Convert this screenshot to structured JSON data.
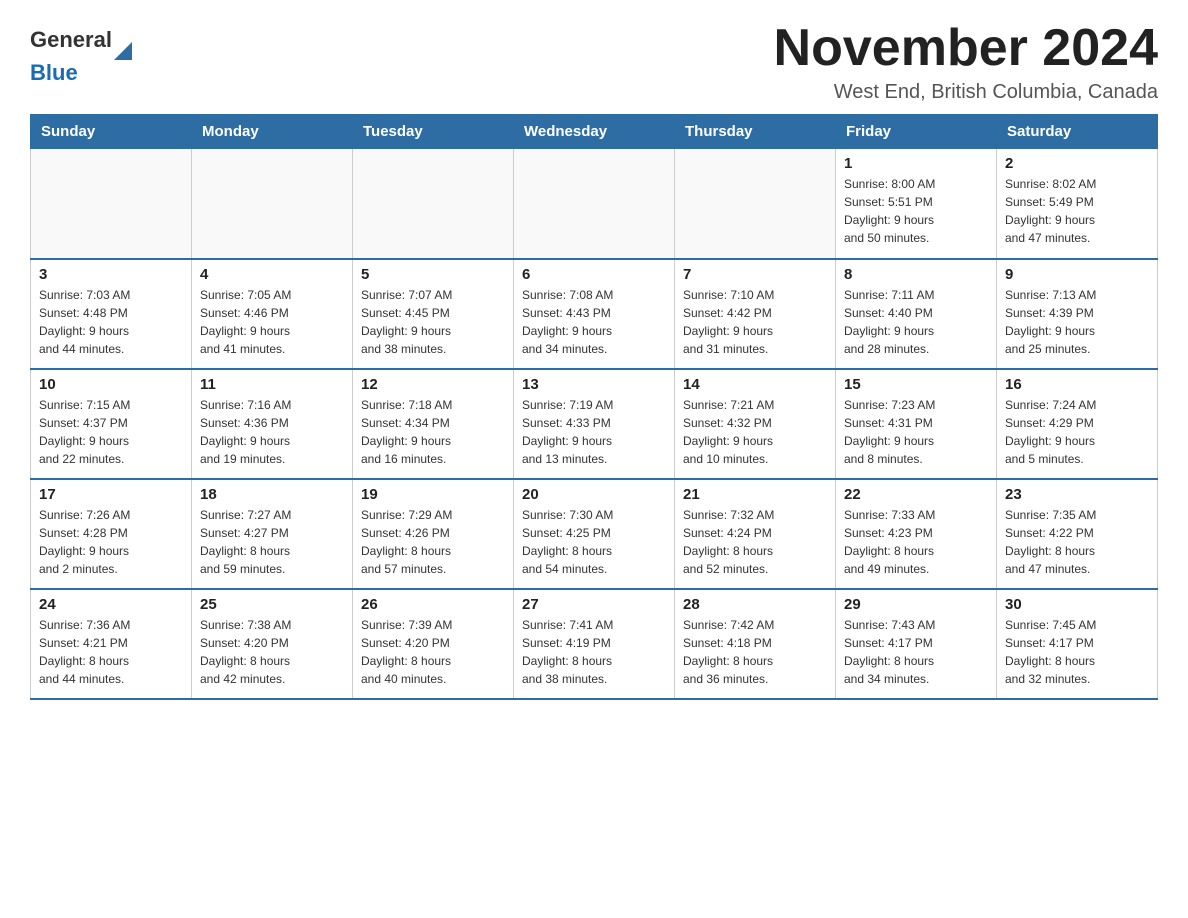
{
  "header": {
    "logo_general": "General",
    "logo_blue": "Blue",
    "month_title": "November 2024",
    "location": "West End, British Columbia, Canada"
  },
  "days_of_week": [
    "Sunday",
    "Monday",
    "Tuesday",
    "Wednesday",
    "Thursday",
    "Friday",
    "Saturday"
  ],
  "weeks": [
    [
      {
        "day": "",
        "info": ""
      },
      {
        "day": "",
        "info": ""
      },
      {
        "day": "",
        "info": ""
      },
      {
        "day": "",
        "info": ""
      },
      {
        "day": "",
        "info": ""
      },
      {
        "day": "1",
        "info": "Sunrise: 8:00 AM\nSunset: 5:51 PM\nDaylight: 9 hours\nand 50 minutes."
      },
      {
        "day": "2",
        "info": "Sunrise: 8:02 AM\nSunset: 5:49 PM\nDaylight: 9 hours\nand 47 minutes."
      }
    ],
    [
      {
        "day": "3",
        "info": "Sunrise: 7:03 AM\nSunset: 4:48 PM\nDaylight: 9 hours\nand 44 minutes."
      },
      {
        "day": "4",
        "info": "Sunrise: 7:05 AM\nSunset: 4:46 PM\nDaylight: 9 hours\nand 41 minutes."
      },
      {
        "day": "5",
        "info": "Sunrise: 7:07 AM\nSunset: 4:45 PM\nDaylight: 9 hours\nand 38 minutes."
      },
      {
        "day": "6",
        "info": "Sunrise: 7:08 AM\nSunset: 4:43 PM\nDaylight: 9 hours\nand 34 minutes."
      },
      {
        "day": "7",
        "info": "Sunrise: 7:10 AM\nSunset: 4:42 PM\nDaylight: 9 hours\nand 31 minutes."
      },
      {
        "day": "8",
        "info": "Sunrise: 7:11 AM\nSunset: 4:40 PM\nDaylight: 9 hours\nand 28 minutes."
      },
      {
        "day": "9",
        "info": "Sunrise: 7:13 AM\nSunset: 4:39 PM\nDaylight: 9 hours\nand 25 minutes."
      }
    ],
    [
      {
        "day": "10",
        "info": "Sunrise: 7:15 AM\nSunset: 4:37 PM\nDaylight: 9 hours\nand 22 minutes."
      },
      {
        "day": "11",
        "info": "Sunrise: 7:16 AM\nSunset: 4:36 PM\nDaylight: 9 hours\nand 19 minutes."
      },
      {
        "day": "12",
        "info": "Sunrise: 7:18 AM\nSunset: 4:34 PM\nDaylight: 9 hours\nand 16 minutes."
      },
      {
        "day": "13",
        "info": "Sunrise: 7:19 AM\nSunset: 4:33 PM\nDaylight: 9 hours\nand 13 minutes."
      },
      {
        "day": "14",
        "info": "Sunrise: 7:21 AM\nSunset: 4:32 PM\nDaylight: 9 hours\nand 10 minutes."
      },
      {
        "day": "15",
        "info": "Sunrise: 7:23 AM\nSunset: 4:31 PM\nDaylight: 9 hours\nand 8 minutes."
      },
      {
        "day": "16",
        "info": "Sunrise: 7:24 AM\nSunset: 4:29 PM\nDaylight: 9 hours\nand 5 minutes."
      }
    ],
    [
      {
        "day": "17",
        "info": "Sunrise: 7:26 AM\nSunset: 4:28 PM\nDaylight: 9 hours\nand 2 minutes."
      },
      {
        "day": "18",
        "info": "Sunrise: 7:27 AM\nSunset: 4:27 PM\nDaylight: 8 hours\nand 59 minutes."
      },
      {
        "day": "19",
        "info": "Sunrise: 7:29 AM\nSunset: 4:26 PM\nDaylight: 8 hours\nand 57 minutes."
      },
      {
        "day": "20",
        "info": "Sunrise: 7:30 AM\nSunset: 4:25 PM\nDaylight: 8 hours\nand 54 minutes."
      },
      {
        "day": "21",
        "info": "Sunrise: 7:32 AM\nSunset: 4:24 PM\nDaylight: 8 hours\nand 52 minutes."
      },
      {
        "day": "22",
        "info": "Sunrise: 7:33 AM\nSunset: 4:23 PM\nDaylight: 8 hours\nand 49 minutes."
      },
      {
        "day": "23",
        "info": "Sunrise: 7:35 AM\nSunset: 4:22 PM\nDaylight: 8 hours\nand 47 minutes."
      }
    ],
    [
      {
        "day": "24",
        "info": "Sunrise: 7:36 AM\nSunset: 4:21 PM\nDaylight: 8 hours\nand 44 minutes."
      },
      {
        "day": "25",
        "info": "Sunrise: 7:38 AM\nSunset: 4:20 PM\nDaylight: 8 hours\nand 42 minutes."
      },
      {
        "day": "26",
        "info": "Sunrise: 7:39 AM\nSunset: 4:20 PM\nDaylight: 8 hours\nand 40 minutes."
      },
      {
        "day": "27",
        "info": "Sunrise: 7:41 AM\nSunset: 4:19 PM\nDaylight: 8 hours\nand 38 minutes."
      },
      {
        "day": "28",
        "info": "Sunrise: 7:42 AM\nSunset: 4:18 PM\nDaylight: 8 hours\nand 36 minutes."
      },
      {
        "day": "29",
        "info": "Sunrise: 7:43 AM\nSunset: 4:17 PM\nDaylight: 8 hours\nand 34 minutes."
      },
      {
        "day": "30",
        "info": "Sunrise: 7:45 AM\nSunset: 4:17 PM\nDaylight: 8 hours\nand 32 minutes."
      }
    ]
  ],
  "colors": {
    "header_bg": "#2e6da4",
    "header_text": "#ffffff",
    "border": "#cccccc",
    "border_accent": "#2e6da4"
  }
}
